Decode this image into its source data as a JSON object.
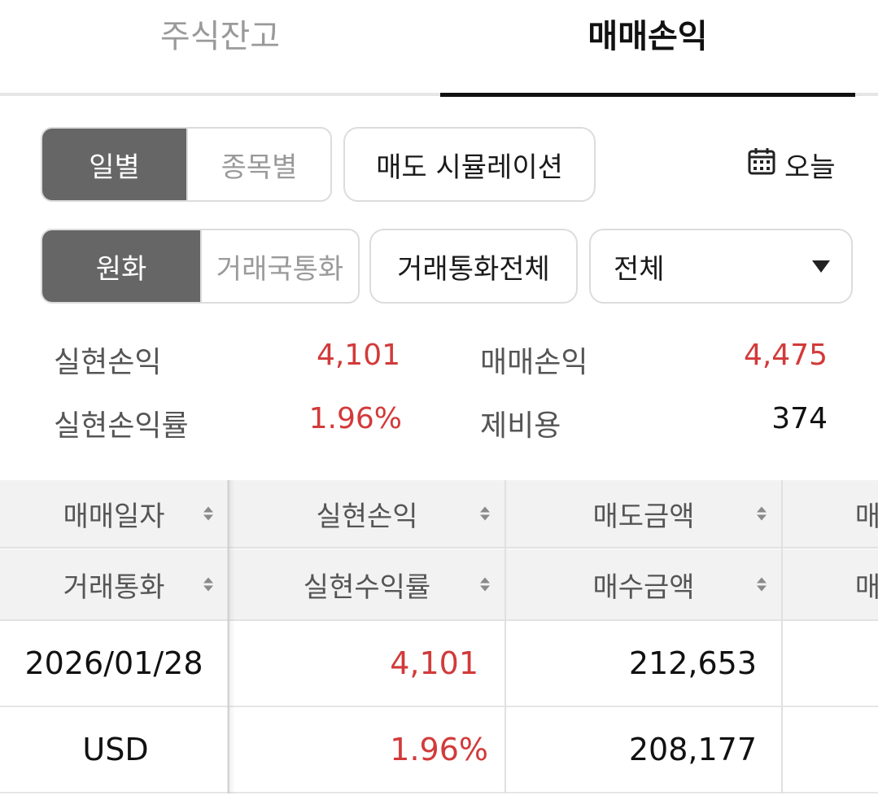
{
  "tabs": {
    "holdings": "주식잔고",
    "trading_pnl": "매매손익"
  },
  "view_toggle": {
    "daily": "일별",
    "by_stock": "종목별"
  },
  "sell_simulation": "매도 시뮬레이션",
  "date_filter": {
    "label": "오늘",
    "icon": "calendar-icon"
  },
  "currency_toggle": {
    "krw": "원화",
    "trade_currency": "거래국통화"
  },
  "currency_all": "거래통화전체",
  "filter_select": {
    "value": "전체"
  },
  "summary": {
    "realized_pnl_label": "실현손익",
    "realized_pnl": "4,101",
    "trading_pnl_label": "매매손익",
    "trading_pnl": "4,475",
    "realized_rate_label": "실현손익률",
    "realized_rate": "1.96%",
    "fees_label": "제비용",
    "fees": "374"
  },
  "table": {
    "headers_row1": [
      "매매일자",
      "실현손익",
      "매도금액",
      "매"
    ],
    "headers_row2": [
      "거래통화",
      "실현수익률",
      "매수금액",
      "매"
    ],
    "rows": [
      {
        "date": "2026/01/28",
        "realized_pnl": "4,101",
        "sell_amount": "212,653"
      },
      {
        "currency": "USD",
        "realized_rate": "1.96%",
        "buy_amount": "208,177"
      }
    ]
  },
  "colors": {
    "accent_red": "#d23a3a",
    "active_gray": "#666666",
    "tab_active": "#111111"
  }
}
